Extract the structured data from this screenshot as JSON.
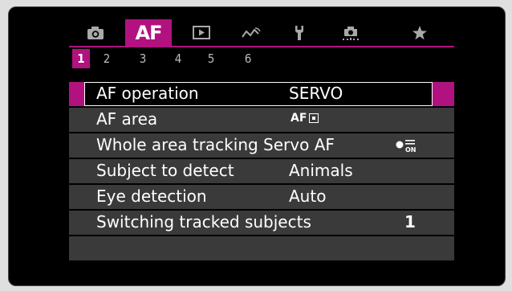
{
  "tabs": [
    {
      "id": "shooting",
      "icon": "camera-icon"
    },
    {
      "id": "af",
      "label": "AF",
      "active": true
    },
    {
      "id": "playback",
      "icon": "playback-icon"
    },
    {
      "id": "wireless",
      "icon": "wireless-icon"
    },
    {
      "id": "setup",
      "icon": "wrench-icon"
    },
    {
      "id": "custom",
      "icon": "custom-functions-icon"
    },
    {
      "id": "mymenu",
      "icon": "star-icon"
    }
  ],
  "pages": [
    "1",
    "2",
    "3",
    "4",
    "5",
    "6"
  ],
  "active_page": "1",
  "menu": {
    "rows": [
      {
        "label": "AF operation",
        "value": "SERVO",
        "selected": true
      },
      {
        "label": "AF area",
        "value_icon": "AF"
      },
      {
        "label": "Whole area tracking Servo AF",
        "value_icon": "tracking-on-icon",
        "icon_text": "ON"
      },
      {
        "label": "Subject to detect",
        "value": "Animals"
      },
      {
        "label": "Eye detection",
        "value": "Auto"
      },
      {
        "label": "Switching tracked subjects",
        "value": "1"
      }
    ]
  },
  "colors": {
    "accent": "#b1127f",
    "row_bg": "#3a3a3a",
    "screen_bg": "#000000",
    "text": "#ffffff"
  }
}
